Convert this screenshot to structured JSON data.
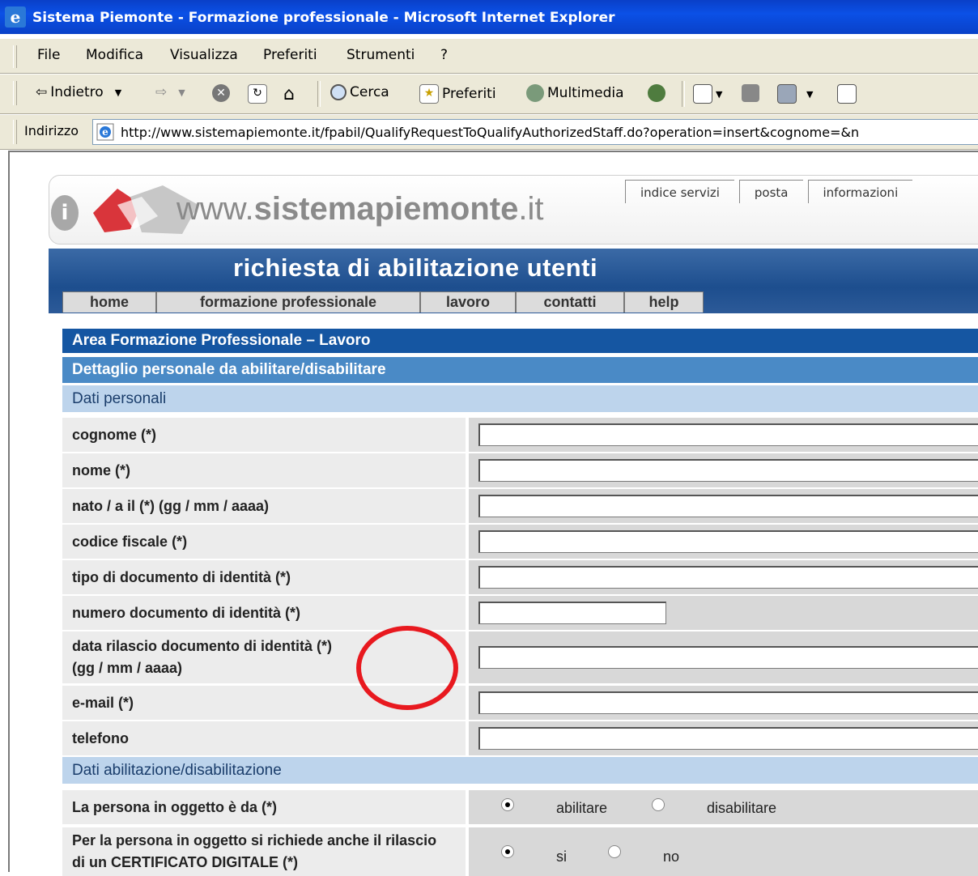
{
  "window": {
    "title": "Sistema Piemonte - Formazione professionale - Microsoft Internet Explorer"
  },
  "menu": [
    "File",
    "Modifica",
    "Visualizza",
    "Preferiti",
    "Strumenti",
    "?"
  ],
  "toolbar": {
    "back": "Indietro",
    "search": "Cerca",
    "favorites": "Preferiti",
    "media": "Multimedia"
  },
  "address": {
    "label": "Indirizzo",
    "url": "http://www.sistemapiemonte.it/fpabil/QualifyRequestToQualifyAuthorizedStaff.do?operation=insert&cognome=&n"
  },
  "site": {
    "logo_prefix": "www.",
    "logo_bold": "sistemapiemonte",
    "logo_suffix": ".it",
    "info_glyph": "i",
    "top_tabs": [
      "indice servizi",
      "posta",
      "informazioni"
    ],
    "banner_title": "richiesta di abilitazione utenti",
    "nav": [
      "home",
      "formazione professionale",
      "lavoro",
      "contatti",
      "help"
    ]
  },
  "form": {
    "area_title": "Area Formazione Professionale – Lavoro",
    "detail_title": "Dettaglio personale da abilitare/disabilitare",
    "personal_section": "Dati personali",
    "fields": [
      {
        "label": "cognome (*)",
        "value": ""
      },
      {
        "label": "nome (*)",
        "value": ""
      },
      {
        "label": "nato / a il (*) (gg / mm / aaaa)",
        "value": ""
      },
      {
        "label": "codice fiscale (*)",
        "value": ""
      },
      {
        "label": "tipo di documento di identità (*)",
        "value": ""
      },
      {
        "label": "numero documento di identità (*)",
        "value": ""
      },
      {
        "label": "data rilascio documento di identità (*) (gg / mm / aaaa)",
        "value": ""
      },
      {
        "label": "e-mail (*)",
        "value": ""
      },
      {
        "label": "telefono",
        "value": ""
      }
    ],
    "abil_section": "Dati abilitazione/disabilitazione",
    "abil_question": "La persona in oggetto è da (*)",
    "abil_options": [
      "abilitare",
      "disabilitare"
    ],
    "abil_selected": "abilitare",
    "cert_question": "Per la persona in oggetto si richiede anche il rilascio di un CERTIFICATO DIGITALE (*)",
    "cert_options": [
      "si",
      "no"
    ],
    "cert_selected": "si"
  },
  "colors": {
    "titlebar": "#0b50e6",
    "section_dark": "#1556a2",
    "section_mid": "#4a8ac6",
    "section_light": "#bdd4ec",
    "annotation": "#e8191f"
  }
}
